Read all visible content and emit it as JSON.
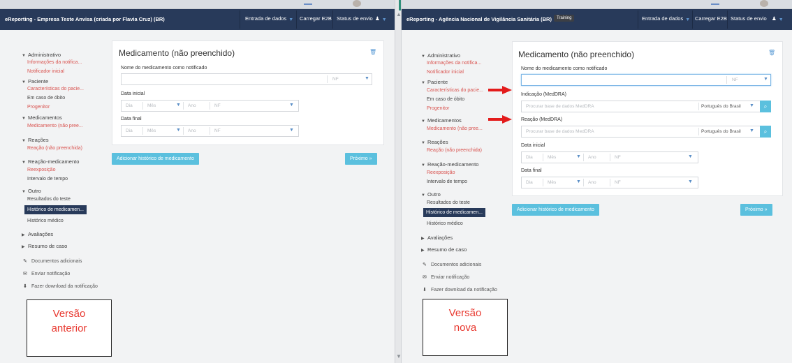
{
  "colors": {
    "navbar": "#283a5a",
    "required_red": "#d9534f",
    "accent_blue": "#5bc0de",
    "callout_red": "#e8382f",
    "arrow_red": "#e31b1b"
  },
  "left": {
    "navbar": {
      "brand": "eReporting - Empresa Teste Anvisa (criada por Flavia Cruz) (BR)",
      "menu_data_entry": "Entrada de dados",
      "menu_load_e2b": "Carregar E2B",
      "menu_send_status": "Status de envio",
      "user_icon": "user-icon"
    },
    "sidebar": {
      "sec_admin": "Administrativo",
      "admin_info": "Informações da notifica...",
      "admin_initial": "Notificador inicial",
      "sec_patient": "Paciente",
      "patient_char": "Características do pacie...",
      "patient_death": "Em caso de óbito",
      "patient_parent": "Progenitor",
      "sec_meds": "Medicamentos",
      "meds_item": "Medicamento (não pree...",
      "sec_reactions": "Reações",
      "reactions_item": "Reação (não preenchida)",
      "sec_reaction_med": "Reação-medicamento",
      "rm_reexposure": "Reexposição",
      "rm_interval": "Intervalo de tempo",
      "sec_other": "Outro",
      "other_tests": "Resultados do teste",
      "other_med_history": "Histórico de medicamen...",
      "other_medical_history": "Histórico médico",
      "sec_evaluations": "Avaliações",
      "sec_case_summary": "Resumo de caso",
      "util_docs": "Documentos adicionais",
      "util_send": "Enviar notificação",
      "util_download": "Fazer download da notificação"
    },
    "form": {
      "title": "Medicamento (não preenchido)",
      "med_name_label": "Nome do medicamento como notificado",
      "nf": "NF",
      "start_label": "Data inicial",
      "end_label": "Data final",
      "day": "Dia",
      "month": "Mês",
      "year": "Ano",
      "add_button": "Adicionar histórico de medicamento",
      "next_button": "Próximo »"
    },
    "callout": {
      "line1": "Versão",
      "line2": "anterior"
    }
  },
  "right": {
    "navbar": {
      "brand": "eReporting - Agência Nacional de Vigilância Sanitária (BR)",
      "badge": "Training",
      "menu_data_entry": "Entrada de dados",
      "menu_load_e2b": "Carregar E2B",
      "menu_send_status": "Status de envio",
      "user_icon": "user-icon"
    },
    "sidebar": {
      "sec_admin": "Administrativo",
      "admin_info": "Informações da notifica...",
      "admin_initial": "Notificador inicial",
      "sec_patient": "Paciente",
      "patient_char": "Características do pacie...",
      "patient_death": "Em caso de óbito",
      "patient_parent": "Progenitor",
      "sec_meds": "Medicamentos",
      "meds_item": "Medicamento (não pree...",
      "sec_reactions": "Reações",
      "reactions_item": "Reação (não preenchida)",
      "sec_reaction_med": "Reação-medicamento",
      "rm_reexposure": "Reexposição",
      "rm_interval": "Intervalo de tempo",
      "sec_other": "Outro",
      "other_tests": "Resultados do teste",
      "other_med_history": "Histórico de medicamen...",
      "other_medical_history": "Histórico médico",
      "sec_evaluations": "Avaliações",
      "sec_case_summary": "Resumo de caso",
      "util_docs": "Documentos adicionais",
      "util_send": "Enviar notificação",
      "util_download": "Fazer download da notificação"
    },
    "form": {
      "title": "Medicamento (não preenchido)",
      "med_name_label": "Nome do medicamento como notificado",
      "nf": "NF",
      "indication_label": "Indicação (MedDRA)",
      "reaction_label": "Reação (MedDRA)",
      "meddra_placeholder": "Procurar base de dados MedDRA",
      "language": "Português do Brasil",
      "start_label": "Data inicial",
      "end_label": "Data final",
      "day": "Dia",
      "month": "Mês",
      "year": "Ano",
      "add_button": "Adicionar histórico de medicamento",
      "next_button": "Próximo »"
    },
    "callout": {
      "line1": "Versão",
      "line2": "nova"
    }
  }
}
